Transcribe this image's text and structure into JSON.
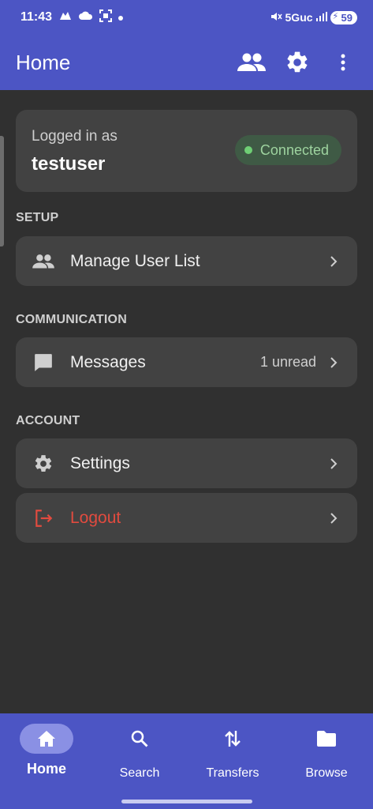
{
  "status_bar": {
    "time": "11:43",
    "network": "5Guc",
    "battery": "59"
  },
  "app_bar": {
    "title": "Home",
    "actions": [
      "people-icon",
      "gear-icon",
      "more-vert-icon"
    ]
  },
  "login": {
    "label": "Logged in as",
    "username": "testuser",
    "status": "Connected"
  },
  "sections": {
    "setup": "SETUP",
    "communication": "COMMUNICATION",
    "account": "ACCOUNT"
  },
  "items": {
    "manage_users": "Manage User List",
    "messages": "Messages",
    "messages_meta": "1 unread",
    "settings": "Settings",
    "logout": "Logout"
  },
  "bottom_nav": {
    "home": "Home",
    "search": "Search",
    "transfers": "Transfers",
    "browse": "Browse"
  },
  "colors": {
    "primary": "#4c55c4",
    "background": "#303030",
    "card": "#424242",
    "connected": "#6fcf75",
    "danger": "#e24b3f"
  }
}
